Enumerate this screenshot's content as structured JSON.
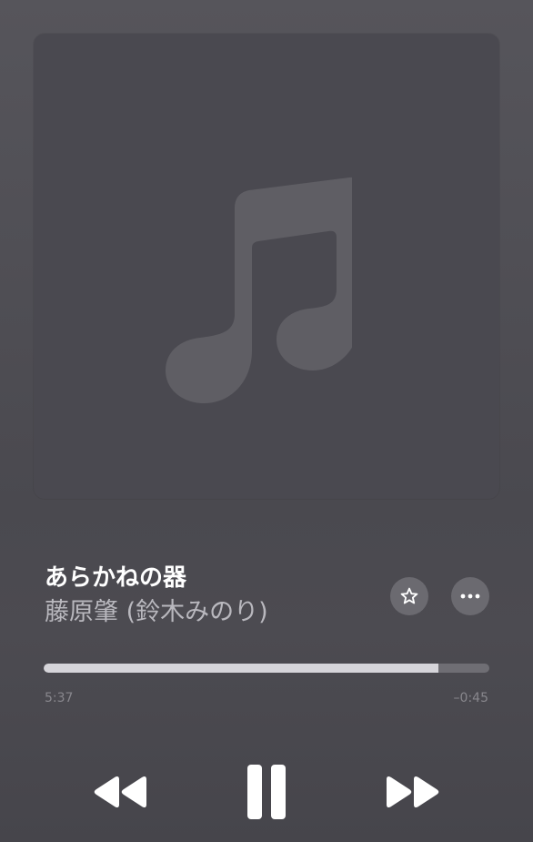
{
  "now_playing": {
    "title": "あらかねの器",
    "artist": "藤原肇 (鈴木みのり)"
  },
  "artwork": {
    "placeholder_icon": "music-note-icon"
  },
  "playback": {
    "elapsed": "5:37",
    "remaining": "–0:45",
    "progress_fraction": 0.885,
    "state": "playing"
  },
  "icons": {
    "favorite": "star-icon",
    "more": "ellipsis-icon",
    "rewind": "backward-icon",
    "pause": "pause-icon",
    "forward": "forward-icon"
  },
  "colors": {
    "background": "#4f4e54",
    "artwork_bg": "#4a4950",
    "note": "#5f5e64",
    "progress_fill": "#d6d5da",
    "progress_track": "#6f6e74",
    "secondary_text": "#b9b8be",
    "button_bg": "#6b6a70"
  }
}
